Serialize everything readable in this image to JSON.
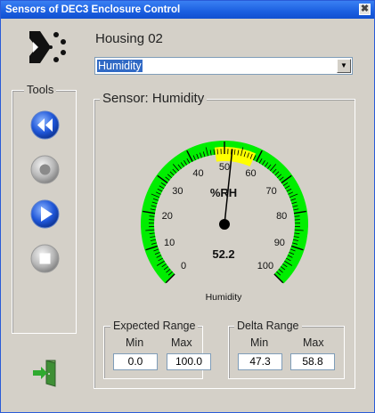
{
  "window": {
    "title": "Sensors of DEC3 Enclosure Control",
    "close_glyph": "✖"
  },
  "header": {
    "housing_label": "Housing 02"
  },
  "sensor_select": {
    "selected": "Humidity"
  },
  "tools": {
    "label": "Tools",
    "buttons": [
      "rewind",
      "record",
      "play",
      "stop"
    ]
  },
  "sensor_panel": {
    "title": "Sensor: Humidity",
    "gauge": {
      "unit": "%RH",
      "value": 52.2,
      "value_text": "52.2",
      "caption": "Humidity",
      "min": 0,
      "max": 100,
      "tick_labels": [
        "0",
        "10",
        "20",
        "30",
        "40",
        "50",
        "60",
        "70",
        "80",
        "90",
        "100"
      ],
      "band_color": "#00ee00",
      "highlight_from": 47.3,
      "highlight_to": 58.8,
      "highlight_color": "#ffff00"
    },
    "expected_range": {
      "label": "Expected Range",
      "min_label": "Min",
      "max_label": "Max",
      "min": "0.0",
      "max": "100.0"
    },
    "delta_range": {
      "label": "Delta Range",
      "min_label": "Min",
      "max_label": "Max",
      "min": "47.3",
      "max": "58.8"
    }
  }
}
